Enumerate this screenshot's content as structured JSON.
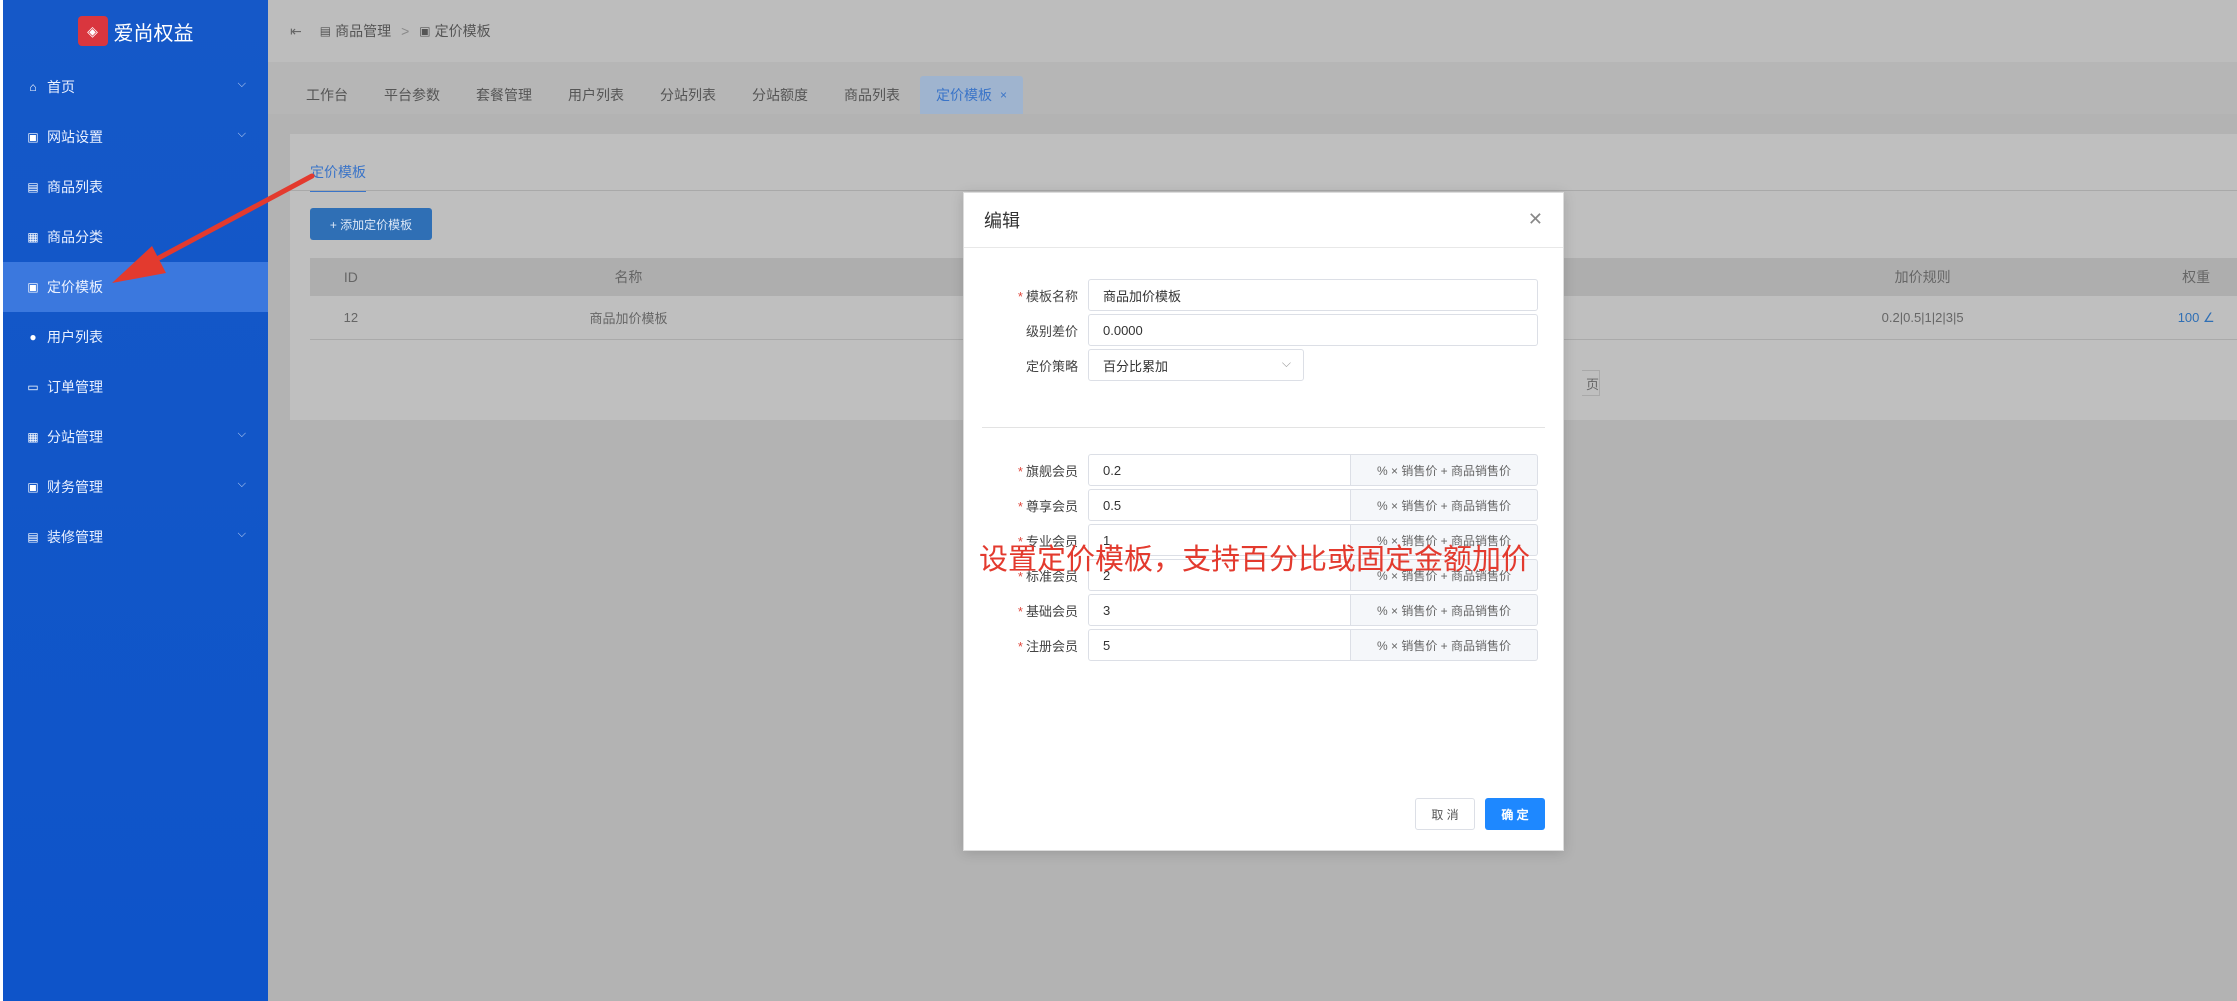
{
  "brand": {
    "name": "爱尚权益",
    "logo_icon": "logo-mark"
  },
  "sidebar": {
    "items": [
      {
        "label": "首页",
        "icon": "home-icon",
        "glyph": "⌂",
        "expandable": true
      },
      {
        "label": "网站设置",
        "icon": "settings-icon",
        "glyph": "▣",
        "expandable": true
      },
      {
        "label": "商品列表",
        "icon": "list-icon",
        "glyph": "▤",
        "expandable": false
      },
      {
        "label": "商品分类",
        "icon": "grid-icon",
        "glyph": "▦",
        "expandable": false
      },
      {
        "label": "定价模板",
        "icon": "template-icon",
        "glyph": "▣",
        "expandable": false,
        "active": true
      },
      {
        "label": "用户列表",
        "icon": "user-icon",
        "glyph": "●",
        "expandable": false
      },
      {
        "label": "订单管理",
        "icon": "cart-icon",
        "glyph": "▭",
        "expandable": false
      },
      {
        "label": "分站管理",
        "icon": "site-icon",
        "glyph": "▦",
        "expandable": true
      },
      {
        "label": "财务管理",
        "icon": "finance-icon",
        "glyph": "▣",
        "expandable": true
      },
      {
        "label": "装修管理",
        "icon": "decor-icon",
        "glyph": "▤",
        "expandable": true
      }
    ]
  },
  "breadcrumb": {
    "fold_glyph": "⇤",
    "items": [
      "商品管理",
      "定价模板"
    ],
    "separator": ">"
  },
  "tabs": {
    "items": [
      "工作台",
      "平台参数",
      "套餐管理",
      "用户列表",
      "分站列表",
      "分站额度",
      "商品列表",
      "定价模板"
    ],
    "active": "定价模板"
  },
  "content": {
    "tab": "定价模板",
    "add_button": "+ 添加定价模板",
    "table": {
      "headers": [
        "ID",
        "名称",
        "加价规则",
        "权重"
      ],
      "rows": [
        {
          "id": "12",
          "name": "商品加价模板",
          "rule": "0.2|0.5|1|2|3|5",
          "weight": "100 ∠"
        }
      ]
    },
    "pager_label": "页"
  },
  "modal": {
    "title": "编辑",
    "fields": {
      "name": {
        "label": "模板名称",
        "required": true,
        "value": "商品加价模板"
      },
      "level_diff": {
        "label": "级别差价",
        "required": false,
        "value": "0.0000"
      },
      "strategy": {
        "label": "定价策略",
        "required": false,
        "value": "百分比累加"
      }
    },
    "suffix": "% × 销售价 + 商品销售价",
    "members": [
      {
        "label": "旗舰会员",
        "value": "0.2"
      },
      {
        "label": "尊享会员",
        "value": "0.5"
      },
      {
        "label": "专业会员",
        "value": "1"
      },
      {
        "label": "标准会员",
        "value": "2"
      },
      {
        "label": "基础会员",
        "value": "3"
      },
      {
        "label": "注册会员",
        "value": "5"
      }
    ],
    "cancel": "取 消",
    "confirm": "确 定"
  },
  "annotation": {
    "text": "设置定价模板，支持百分比或固定金额加价",
    "color": "#e33a2e"
  }
}
